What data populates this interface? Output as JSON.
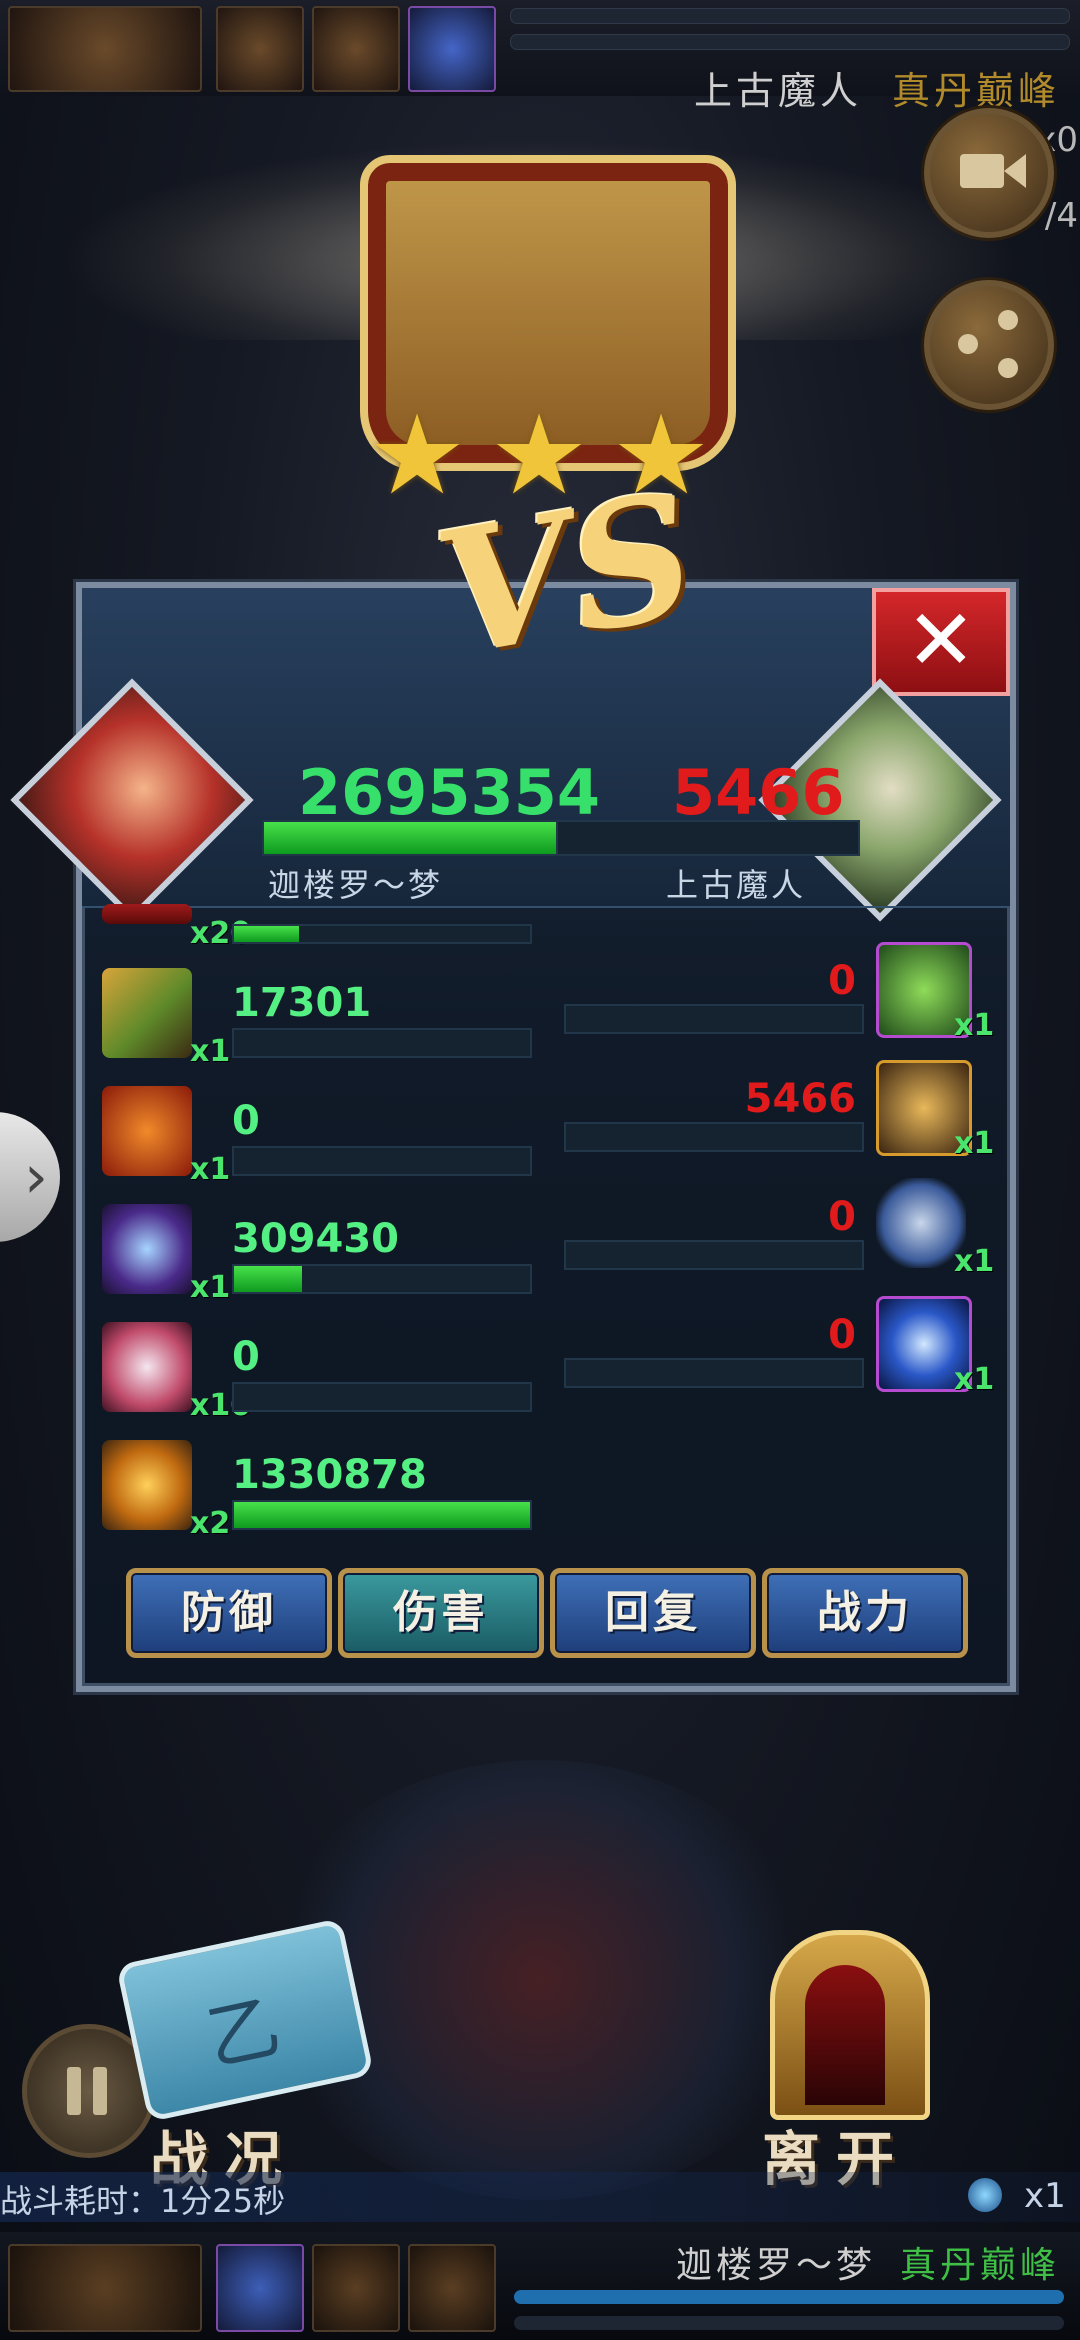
{
  "top_bar": {
    "enemy_name": "上古魔人",
    "enemy_realm": "真丹巅峰",
    "partial_counts": [
      "x0",
      "/4"
    ]
  },
  "battle_result": {
    "stars": [
      "★",
      "★",
      "★"
    ]
  },
  "vs_panel": {
    "vs_text": "VS",
    "close_glyph": "✕",
    "left": {
      "name": "迦楼罗～梦",
      "power": "2695354",
      "power_fill": 1.0
    },
    "right": {
      "name": "上古魔人",
      "power": "5466",
      "power_fill": 0.0
    },
    "partial_row": {
      "count": "x20",
      "fill": 0.22
    },
    "rows": [
      {
        "left_value": "17301",
        "left_count": "x1",
        "left_fill": 0.0,
        "right_value": "0",
        "right_count": "x1",
        "right_fill": 0.0,
        "left_icon": "sword-icon",
        "right_icon": "claw-slash-icon"
      },
      {
        "left_value": "0",
        "left_count": "x1",
        "left_fill": 0.0,
        "right_value": "5466",
        "right_count": "x1",
        "right_fill": 0.0,
        "left_icon": "armor-icon",
        "right_icon": "crack-burst-icon"
      },
      {
        "left_value": "309430",
        "left_count": "x1",
        "left_fill": 0.23,
        "right_value": "0",
        "right_count": "x1",
        "right_fill": 0.0,
        "left_icon": "blade-icon",
        "right_icon": "hammer-icon"
      },
      {
        "left_value": "0",
        "left_count": "x10",
        "left_fill": 0.0,
        "right_value": "0",
        "right_count": "x1",
        "right_fill": 0.0,
        "left_icon": "mask-icon",
        "right_icon": "vortex-icon"
      },
      {
        "left_value": "1330878",
        "left_count": "x2",
        "left_fill": 1.0,
        "left_icon": "fire-blade-icon"
      }
    ],
    "tabs": [
      "防御",
      "伤害",
      "回复",
      "战力"
    ],
    "active_tab": "伤害"
  },
  "side_arrow": "›",
  "bottom": {
    "battle_report_label": "战况",
    "scroll_glyph": "乙",
    "leave_label": "离开",
    "battle_time": "战斗耗时：1分25秒",
    "orb_count": "x1",
    "player_name": "迦楼罗～梦",
    "player_realm": "真丹巅峰"
  },
  "colors": {
    "left_power": "#36e06a",
    "right_power": "#e11b1b",
    "bar_green": "#1ab62e",
    "tab_blue": "#2f5ea8",
    "tab_border": "#b8914a"
  }
}
